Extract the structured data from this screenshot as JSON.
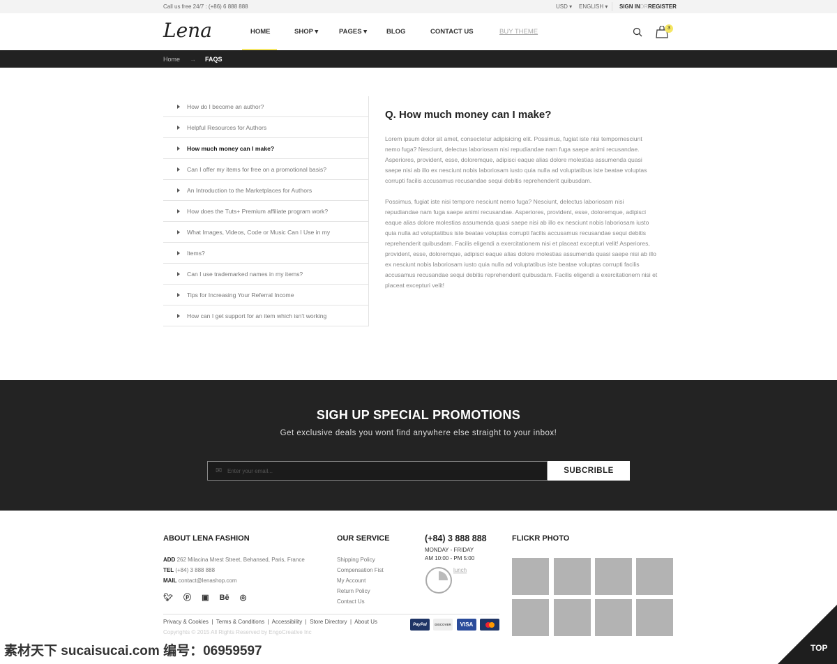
{
  "topbar": {
    "phone": "Call us free 24/7 : (+86) 6 888 888",
    "currency": "USD",
    "language": "ENGLISH",
    "sign_in": "SIGN IN",
    "or": "OR",
    "register": "REGISTER"
  },
  "header": {
    "logo": "Lena",
    "nav": [
      "HOME",
      "SHOP",
      "PAGES",
      "BLOG",
      "CONTACT US",
      "BUY THEME"
    ],
    "cart_count": "3",
    "accent": "#f5e663"
  },
  "breadcrumb": {
    "home": "Home",
    "sep": "→",
    "current": "FAQS"
  },
  "faq": {
    "items": [
      "How do I become an author?",
      "Helpful Resources for Authors",
      "How much money can I make?",
      "Can I offer my items for free on a promotional basis?",
      "An Introduction to the Marketplaces for Authors",
      "How does the Tuts+ Premium affiliate program work?",
      "What Images, Videos, Code or Music Can I Use in my",
      "Items?",
      "Can I use trademarked names in my items?",
      "Tips for Increasing Your Referral Income",
      "How can I get support for an item which isn't working"
    ],
    "active_index": 2,
    "title": "Q. How much money can I make?",
    "paragraphs": [
      "Lorem ipsum dolor sit amet, consectetur adipisicing elit. Possimus, fugiat iste nisi tempornesciunt nemo fuga? Nesciunt, delectus laboriosam nisi repudiandae nam fuga saepe animi recusandae. Asperiores, provident, esse, doloremque, adipisci eaque alias dolore molestias assumenda quasi saepe nisi ab illo ex nesciunt nobis laboriosam iusto quia nulla ad voluptatibus iste beatae voluptas corrupti facilis accusamus recusandae sequi debitis reprehenderit quibusdam.",
      "Possimus, fugiat iste nisi tempore nesciunt nemo fuga? Nesciunt, delectus laboriosam nisi repudiandae nam fuga saepe animi recusandae. Asperiores, provident, esse, doloremque, adipisci eaque alias dolore molestias assumenda quasi saepe nisi ab illo ex nesciunt nobis laboriosam iusto quia nulla ad voluptatibus iste beatae voluptas corrupti facilis accusamus recusandae sequi debitis reprehenderit quibusdam. Facilis eligendi a exercitationem nisi et placeat excepturi velit! Asperiores, provident, esse, doloremque, adipisci eaque alias dolore molestias assumenda quasi saepe nisi ab illo ex nesciunt nobis laboriosam iusto quia nulla ad voluptatibus iste beatae voluptas corrupti facilis accusamus recusandae sequi debitis reprehenderit quibusdam. Facilis eligendi a exercitationem nisi et placeat excepturi velit!"
    ]
  },
  "promo": {
    "title": "SIGH UP SPECIAL PROMOTIONS",
    "subtitle": "Get exclusive deals you wont find anywhere else straight to your inbox!",
    "placeholder": "Enter your email...",
    "button": "SUBCRIBLE"
  },
  "footer": {
    "about_title": "ABOUT LENA FASHION",
    "add_label": "ADD",
    "address": "262 Milacina Mrest Street, Behansed, Paris, France",
    "tel_label": "TEL",
    "tel": "(+84) 3 888 888",
    "mail_label": "MAIL",
    "mail": "contact@lenashop.com",
    "service_title": "OUR SERVICE",
    "service_links": [
      "Shipping Policy",
      "Compensation Fist",
      "My Account",
      "Return Policy",
      "Contact Us"
    ],
    "phone": "(+84) 3 888 888",
    "days": "MONDAY - FRIDAY",
    "hours": "AM 10:00 - PM 5:00",
    "lunch": "lunch",
    "flickr_title": "FLICKR PHOTO",
    "bottom_links": [
      "Privacy & Cookies",
      "Terms & Conditions",
      "Accessibility",
      "Store Directory",
      "About Us"
    ],
    "copyright": "Copyrights © 2015 All Rights Reserved by EngoCreative Inc",
    "payments": [
      "PayPal",
      "DISCOVER",
      "VISA",
      "MC"
    ],
    "top": "TOP"
  },
  "watermark": "素材天下 sucaisucai.com  编号：06959597"
}
